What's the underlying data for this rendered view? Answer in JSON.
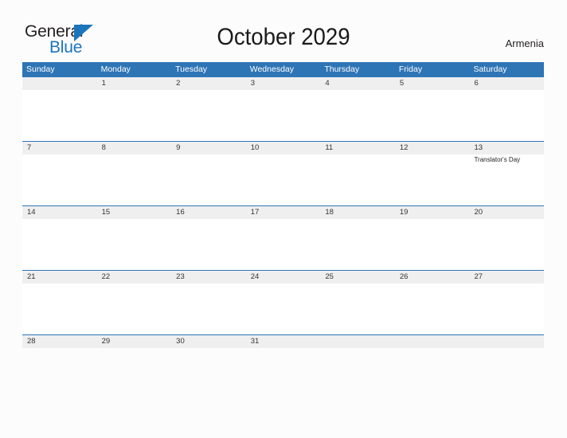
{
  "logo": {
    "line1": "General",
    "line2": "Blue",
    "flag_icon": "triangle-flag-icon",
    "color_dark": "#231f20",
    "color_blue": "#1b75bb"
  },
  "header": {
    "title": "October 2029",
    "region": "Armenia"
  },
  "colors": {
    "header_blue": "#2e75b6",
    "date_strip_gray": "#efefef",
    "page_background": "#fcfcfc",
    "text": "#231f20"
  },
  "calendar": {
    "weekday_headers": [
      "Sunday",
      "Monday",
      "Tuesday",
      "Wednesday",
      "Thursday",
      "Friday",
      "Saturday"
    ],
    "weeks": [
      {
        "days": [
          {
            "date": "",
            "event": ""
          },
          {
            "date": "1",
            "event": ""
          },
          {
            "date": "2",
            "event": ""
          },
          {
            "date": "3",
            "event": ""
          },
          {
            "date": "4",
            "event": ""
          },
          {
            "date": "5",
            "event": ""
          },
          {
            "date": "6",
            "event": ""
          }
        ]
      },
      {
        "days": [
          {
            "date": "7",
            "event": ""
          },
          {
            "date": "8",
            "event": ""
          },
          {
            "date": "9",
            "event": ""
          },
          {
            "date": "10",
            "event": ""
          },
          {
            "date": "11",
            "event": ""
          },
          {
            "date": "12",
            "event": ""
          },
          {
            "date": "13",
            "event": "Translator's Day"
          }
        ]
      },
      {
        "days": [
          {
            "date": "14",
            "event": ""
          },
          {
            "date": "15",
            "event": ""
          },
          {
            "date": "16",
            "event": ""
          },
          {
            "date": "17",
            "event": ""
          },
          {
            "date": "18",
            "event": ""
          },
          {
            "date": "19",
            "event": ""
          },
          {
            "date": "20",
            "event": ""
          }
        ]
      },
      {
        "days": [
          {
            "date": "21",
            "event": ""
          },
          {
            "date": "22",
            "event": ""
          },
          {
            "date": "23",
            "event": ""
          },
          {
            "date": "24",
            "event": ""
          },
          {
            "date": "25",
            "event": ""
          },
          {
            "date": "26",
            "event": ""
          },
          {
            "date": "27",
            "event": ""
          }
        ]
      },
      {
        "days": [
          {
            "date": "28",
            "event": ""
          },
          {
            "date": "29",
            "event": ""
          },
          {
            "date": "30",
            "event": ""
          },
          {
            "date": "31",
            "event": ""
          },
          {
            "date": "",
            "event": ""
          },
          {
            "date": "",
            "event": ""
          },
          {
            "date": "",
            "event": ""
          }
        ]
      }
    ]
  }
}
